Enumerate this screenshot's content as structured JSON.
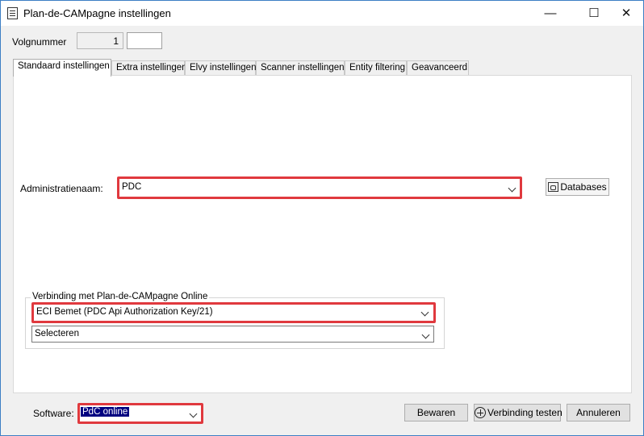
{
  "window": {
    "title": "Plan-de-CAMpagne instellingen",
    "minimize_icon": "minimize-icon",
    "maximize_icon": "maximize-icon",
    "close_icon": "close-icon"
  },
  "header": {
    "volgnummer_label": "Volgnummer",
    "volgnummer_value": "1",
    "volgnummer_extra_value": ""
  },
  "tabs": [
    {
      "label": "Standaard instellingen",
      "active": true
    },
    {
      "label": "Extra instellingen",
      "active": false
    },
    {
      "label": "Elvy instellingen",
      "active": false
    },
    {
      "label": "Scanner instellingen",
      "active": false
    },
    {
      "label": "Entity filtering",
      "active": false
    },
    {
      "label": "Geavanceerd",
      "active": false
    }
  ],
  "main": {
    "administratienaam_label": "Administratienaam:",
    "administratienaam_value": "PDC",
    "databases_label": "Databases",
    "connection_group_label": "Verbinding met Plan-de-CAMpagne Online",
    "connection_key_value": "ECI Bemet (PDC Api Authorization Key/21)",
    "connection_select_value": "Selecteren"
  },
  "footer": {
    "software_label": "Software:",
    "software_value": "PdC online",
    "save_label": "Bewaren",
    "test_connection_label": "Verbinding testen",
    "cancel_label": "Annuleren"
  },
  "colors": {
    "highlight": "#e0393e",
    "selection": "#000080",
    "window_border": "#3d7fc4"
  }
}
